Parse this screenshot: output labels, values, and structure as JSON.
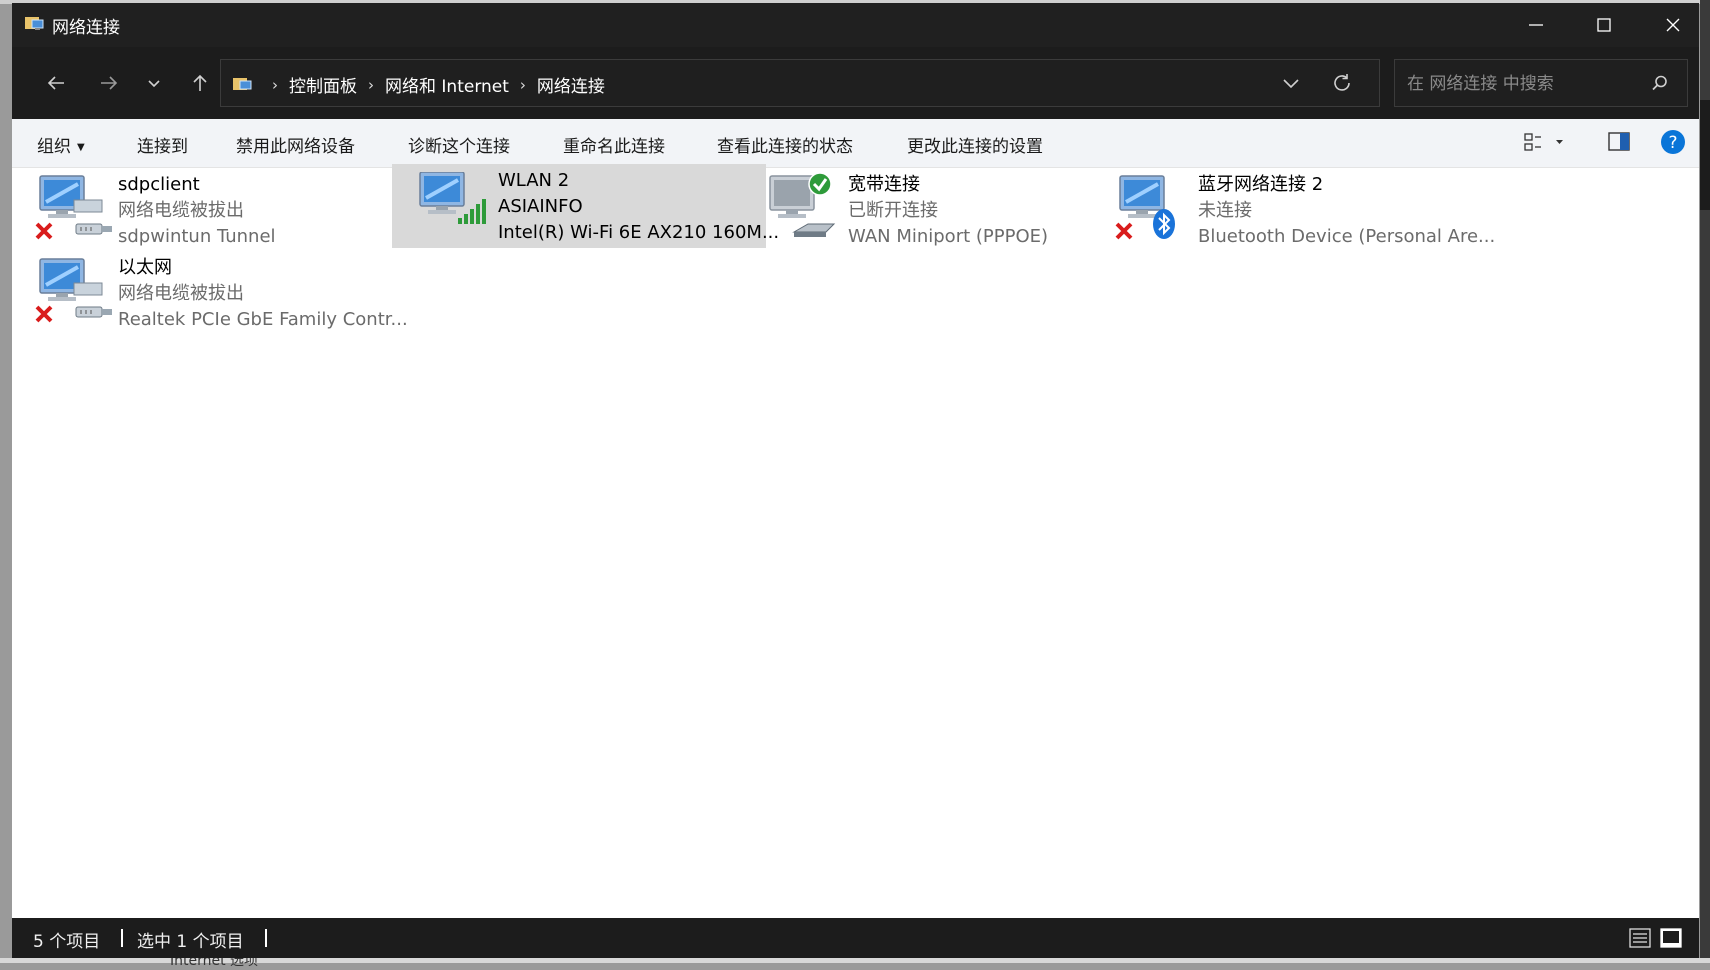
{
  "window": {
    "title": "网络连接",
    "app_icon": "network-connections-folder-icon"
  },
  "nav": {
    "back_icon": "arrow-left-icon",
    "forward_icon": "arrow-right-icon",
    "recent_icon": "chevron-down-icon",
    "up_icon": "arrow-up-icon"
  },
  "address": {
    "crumbs": [
      "控制面板",
      "网络和 Internet",
      "网络连接"
    ]
  },
  "search": {
    "placeholder": "在 网络连接 中搜索"
  },
  "commands": {
    "organize": "组织",
    "connect_to": "连接到",
    "disable": "禁用此网络设备",
    "diagnose": "诊断这个连接",
    "rename": "重命名此连接",
    "view_status": "查看此连接的状态",
    "change_settings": "更改此连接的设置"
  },
  "items": [
    {
      "name": "sdpclient",
      "status": "网络电缆被拔出",
      "device": "sdpwintun Tunnel",
      "icon": "ethernet-disconnected-icon",
      "selected": false
    },
    {
      "name": "WLAN 2",
      "status": "ASIAINFO",
      "device": "Intel(R) Wi-Fi 6E AX210 160M...",
      "icon": "wifi-connected-icon",
      "selected": true
    },
    {
      "name": "宽带连接",
      "status": "已断开连接",
      "device": "WAN Miniport (PPPOE)",
      "icon": "broadband-icon",
      "selected": false
    },
    {
      "name": "蓝牙网络连接 2",
      "status": "未连接",
      "device": "Bluetooth Device (Personal Are...",
      "icon": "bluetooth-disconnected-icon",
      "selected": false
    },
    {
      "name": "以太网",
      "status": "网络电缆被拔出",
      "device": "Realtek PCIe GbE Family Contr...",
      "icon": "ethernet-disconnected-icon",
      "selected": false
    }
  ],
  "statusbar": {
    "count": "5 个项目",
    "selected": "选中 1 个项目"
  },
  "background": {
    "behind_text": "Internet 选项"
  },
  "colors": {
    "titlebar": "#202020",
    "selection": "#d9d9d9",
    "help_blue": "#0067c0",
    "error_red": "#d91c1c"
  }
}
